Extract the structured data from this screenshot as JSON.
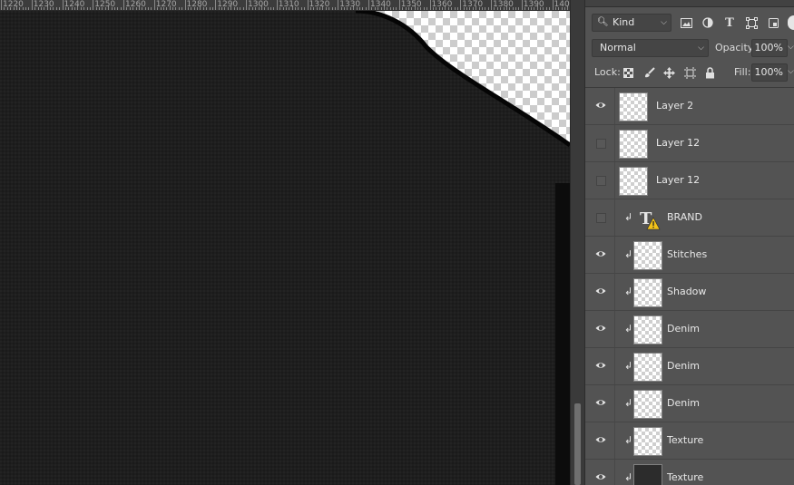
{
  "ruler": {
    "labels": [
      "1220",
      "1230",
      "1240",
      "1250",
      "1260",
      "1270",
      "1280",
      "1290",
      "1300",
      "1310",
      "1320",
      "1330",
      "1340",
      "1350",
      "1360",
      "1370",
      "1380",
      "1390",
      "1400"
    ]
  },
  "layers_panel": {
    "filter_kind": "Kind",
    "filter_icons": [
      "pixel-filter-icon",
      "adjustment-filter-icon",
      "type-filter-icon",
      "shape-filter-icon",
      "smart-object-filter-icon"
    ],
    "blend_mode": "Normal",
    "opacity_label": "Opacity:",
    "opacity_value": "100%",
    "lock_label": "Lock:",
    "lock_icons": [
      "lock-transparent-pixels-icon",
      "lock-image-pixels-icon",
      "lock-position-icon",
      "lock-artboard-icon",
      "lock-all-icon"
    ],
    "fill_label": "Fill:",
    "fill_value": "100%",
    "layers": [
      {
        "name": "Layer 2",
        "visible": true,
        "clipped": false,
        "type": "pixel",
        "thumb": "transparent"
      },
      {
        "name": "Layer 12",
        "visible": false,
        "clipped": false,
        "type": "pixel",
        "thumb": "transparent"
      },
      {
        "name": "Layer 12",
        "visible": false,
        "clipped": false,
        "type": "pixel",
        "thumb": "transparent"
      },
      {
        "name": "BRAND",
        "visible": false,
        "clipped": true,
        "type": "text",
        "warning": true
      },
      {
        "name": "Stitches",
        "visible": true,
        "clipped": true,
        "type": "pixel",
        "thumb": "transparent"
      },
      {
        "name": "Shadow",
        "visible": true,
        "clipped": true,
        "type": "pixel",
        "thumb": "transparent"
      },
      {
        "name": "Denim",
        "visible": true,
        "clipped": true,
        "type": "pixel",
        "thumb": "transparent"
      },
      {
        "name": "Denim",
        "visible": true,
        "clipped": true,
        "type": "pixel",
        "thumb": "transparent"
      },
      {
        "name": "Denim",
        "visible": true,
        "clipped": true,
        "type": "pixel",
        "thumb": "transparent"
      },
      {
        "name": "Texture",
        "visible": true,
        "clipped": true,
        "type": "pixel",
        "thumb": "transparent"
      },
      {
        "name": "Texture",
        "visible": true,
        "clipped": true,
        "type": "pixel",
        "thumb": "dark"
      }
    ]
  }
}
